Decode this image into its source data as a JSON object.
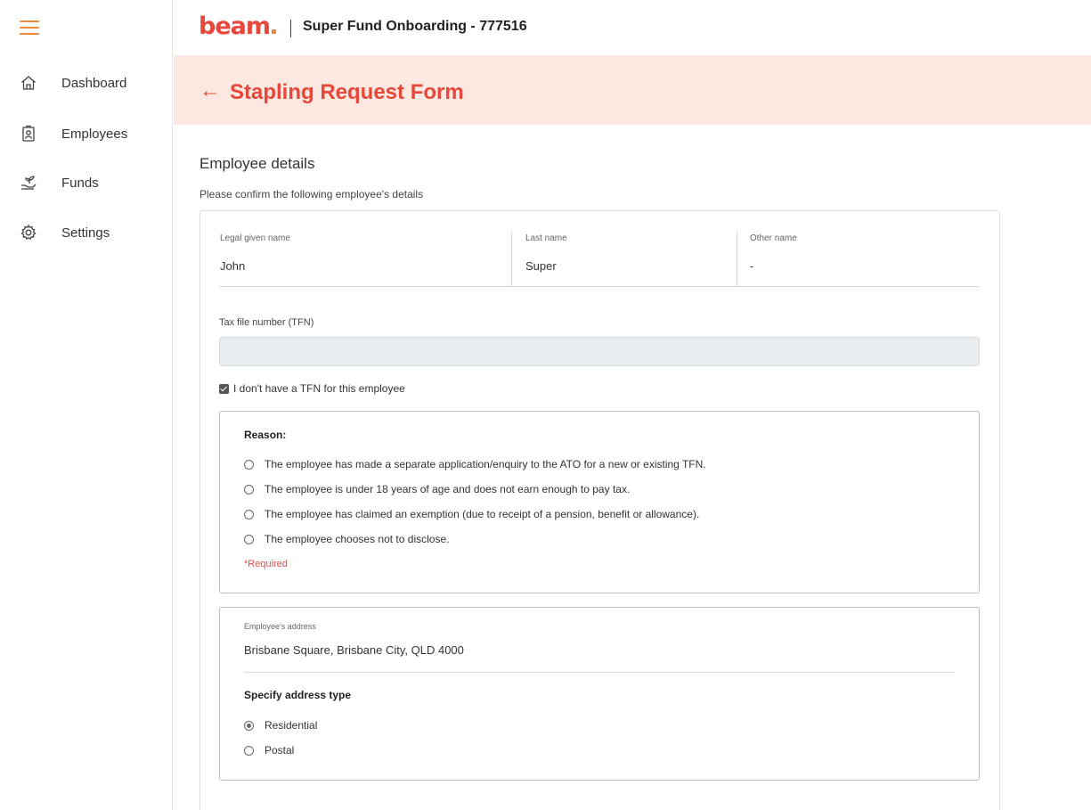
{
  "sidebar": {
    "items": [
      {
        "label": "Dashboard",
        "icon": "home-icon"
      },
      {
        "label": "Employees",
        "icon": "employee-badge-icon"
      },
      {
        "label": "Funds",
        "icon": "hand-plant-icon"
      },
      {
        "label": "Settings",
        "icon": "gear-icon"
      }
    ]
  },
  "header": {
    "logo": "beam",
    "title": "Super Fund Onboarding - 777516"
  },
  "banner": {
    "back": "←",
    "title": "Stapling Request Form"
  },
  "section": {
    "title": "Employee details",
    "subtitle": "Please confirm the following employee's details"
  },
  "names": {
    "given": {
      "label": "Legal given name",
      "value": "John"
    },
    "last": {
      "label": "Last name",
      "value": "Super"
    },
    "other": {
      "label": "Other name",
      "value": "-"
    }
  },
  "tfn": {
    "label": "Tax file number (TFN)",
    "value": "",
    "no_tfn_label": "I don't have a TFN for this employee",
    "no_tfn_checked": true
  },
  "reason": {
    "title": "Reason:",
    "options": [
      "The employee has made a separate application/enquiry to the ATO for a new or existing TFN.",
      "The employee is under 18 years of age and does not earn enough to pay tax.",
      "The employee has claimed an exemption (due to receipt of a pension, benefit or allowance).",
      "The employee chooses not to disclose."
    ],
    "required": "*Required"
  },
  "address": {
    "label": "Employee's address",
    "value": "Brisbane Square, Brisbane City, QLD 4000",
    "type_title": "Specify address type",
    "types": [
      "Residential",
      "Postal"
    ],
    "selected": "Residential"
  },
  "colors": {
    "brand": "#e8483b",
    "accent": "#f0883c",
    "banner_bg": "#fbe8e0"
  }
}
